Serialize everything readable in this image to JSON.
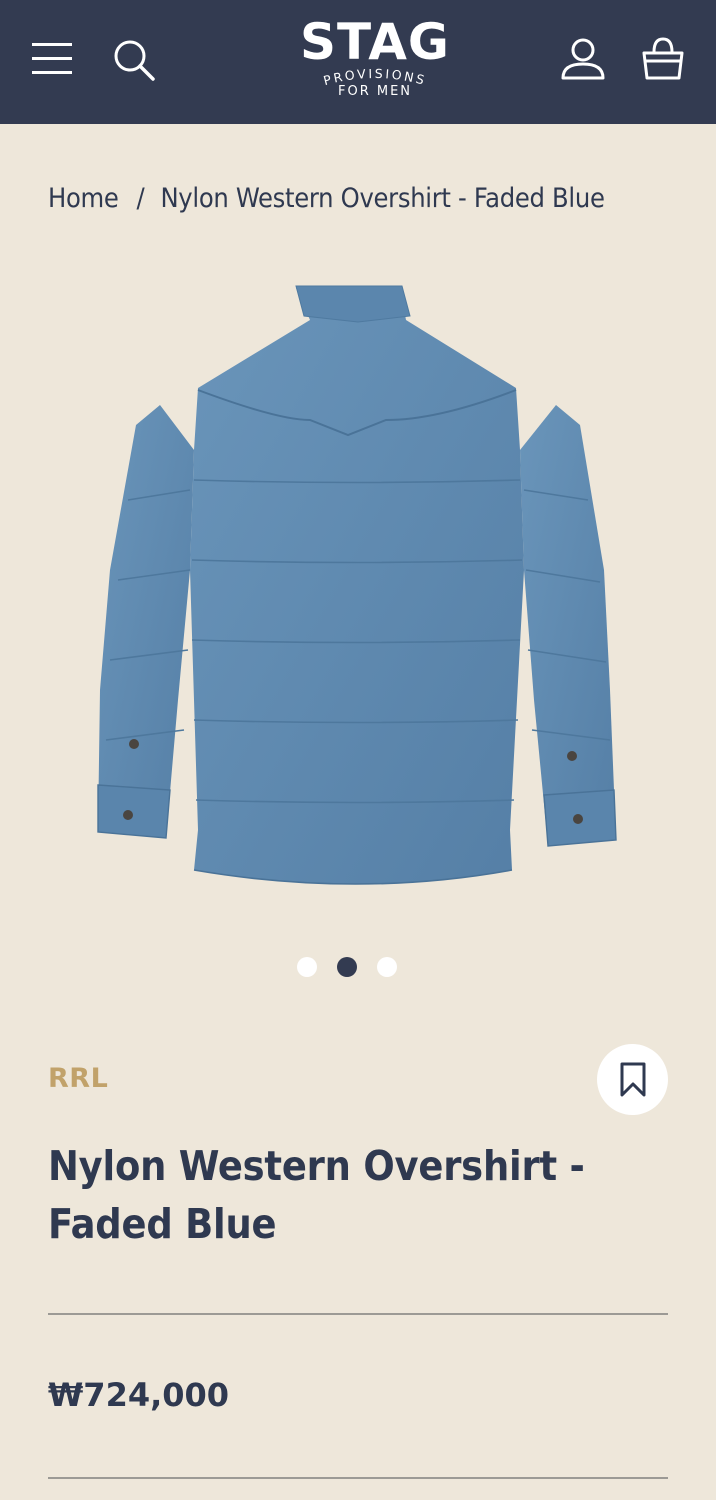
{
  "header": {
    "logo": {
      "word": "STAG",
      "line1": "PROVISIONS",
      "line2": "FOR MEN"
    },
    "icons": [
      "menu-icon",
      "search-icon",
      "account-icon",
      "bag-icon"
    ]
  },
  "breadcrumb": {
    "home": "Home",
    "separator": "/",
    "current": "Nylon Western Overshirt - Faded Blue"
  },
  "gallery": {
    "slide_count": 3,
    "active_slide": 2
  },
  "product": {
    "brand": "RRL",
    "title": "Nylon Western Overshirt - Faded Blue",
    "price": "₩724,000",
    "color": "#5f8bb0"
  },
  "theme": {
    "header_bg": "#333b51",
    "page_bg": "#eee7da",
    "accent": "#c1a26a",
    "text": "#2f3950"
  }
}
